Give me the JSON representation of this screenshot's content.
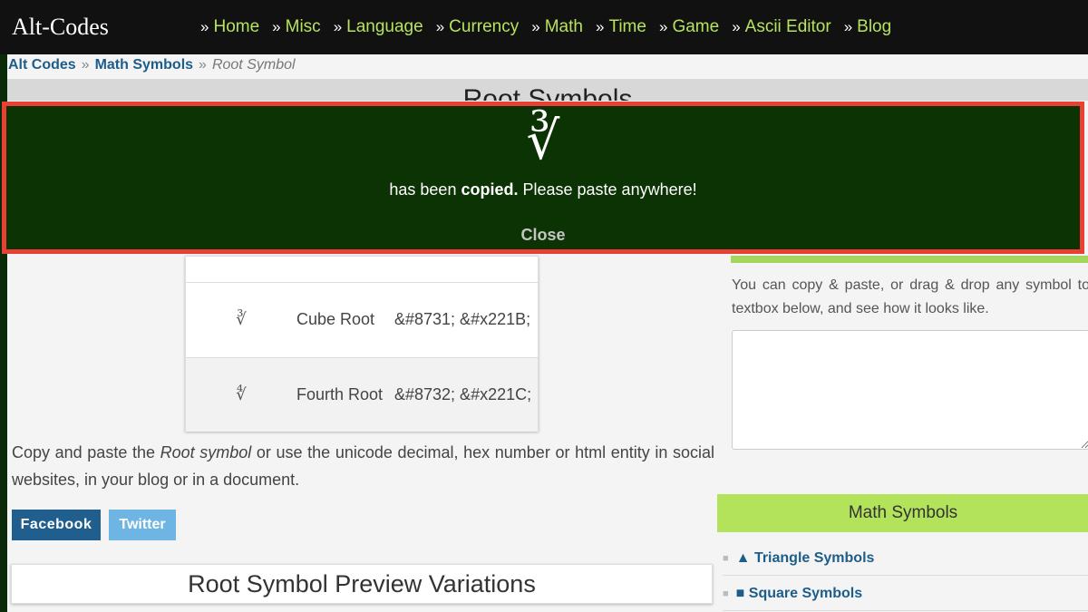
{
  "site": {
    "logo": "Alt-Codes"
  },
  "nav": {
    "separator": "»",
    "items": [
      "Home",
      "Misc",
      "Language",
      "Currency",
      "Math",
      "Time",
      "Game",
      "Ascii Editor",
      "Blog"
    ]
  },
  "breadcrumb": {
    "items": [
      "Alt Codes",
      "Math Symbols"
    ],
    "separator": "»",
    "current": "Root Symbol"
  },
  "page_title": "Root Symbols",
  "table": {
    "rows": [
      {
        "symbol": "∛",
        "name": "Cube Root",
        "codes": "&#8731; &#x221B;"
      },
      {
        "symbol": "∜",
        "name": "Fourth Root",
        "codes": "&#8732; &#x221C;"
      }
    ]
  },
  "description": {
    "before": "Copy and paste the ",
    "emphasis": "Root symbol",
    "after": " or use the unicode decimal, hex number or html entity in social websites, in your blog or in a document."
  },
  "share": {
    "facebook": "Facebook",
    "twitter": "Twitter"
  },
  "preview_title": "Root Symbol Preview Variations",
  "sidebar": {
    "copy_text": "You can copy & paste, or drag & drop any symbol to textbox below, and see how it looks like.",
    "math_header": "Math Symbols",
    "items": [
      {
        "label": "▲ Triangle Symbols"
      },
      {
        "label": "■ Square Symbols"
      }
    ]
  },
  "overlay": {
    "symbol": "∛",
    "msg_before": "has been ",
    "msg_bold": "copied.",
    "msg_after": " Please paste anywhere!",
    "close": "Close"
  },
  "colors": {
    "nav_link": "#b7e35d",
    "overlay_bg": "#0c3303",
    "overlay_border": "#e84133",
    "link_blue": "#1d5d8a",
    "math_header_bg": "#b3e35b"
  }
}
